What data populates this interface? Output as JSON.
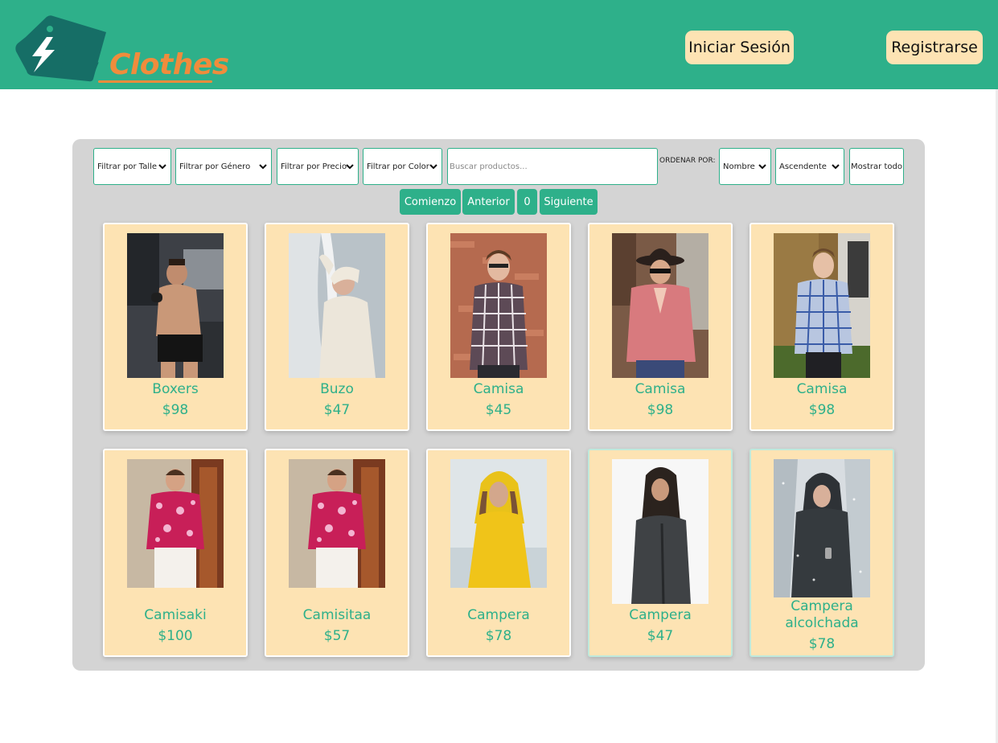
{
  "header": {
    "logo_text": "Clothes",
    "login_label": "Iniciar Sesión",
    "register_label": "Registrarse"
  },
  "filters": {
    "size": "Filtrar por Talle",
    "gender": "Filtrar por Género",
    "price": "Filtrar por Precio",
    "color": "Filtrar por Color",
    "search_placeholder": "Buscar productos...",
    "order_label": "ORDENAR POR:",
    "order_field": "Nombre",
    "order_dir": "Ascendente",
    "show_all": "Mostrar todo"
  },
  "pagination": {
    "first": "Comienzo",
    "prev": "Anterior",
    "page": "0",
    "next": "Siguiente"
  },
  "products": [
    {
      "name": "Boxers",
      "price": "$98"
    },
    {
      "name": "Buzo",
      "price": "$47"
    },
    {
      "name": "Camisa",
      "price": "$45"
    },
    {
      "name": "Camisa",
      "price": "$98"
    },
    {
      "name": "Camisa",
      "price": "$98"
    },
    {
      "name": "Camisaki",
      "price": "$100"
    },
    {
      "name": "Camisitaa",
      "price": "$57"
    },
    {
      "name": "Campera",
      "price": "$78"
    },
    {
      "name": "Campera",
      "price": "$47"
    },
    {
      "name": "Campera alcolchada",
      "price": "$78"
    }
  ],
  "colors": {
    "brand": "#2eb08a",
    "accent": "#f08c3c",
    "card_bg": "#fde3b3",
    "panel_bg": "#d4d4d4"
  }
}
